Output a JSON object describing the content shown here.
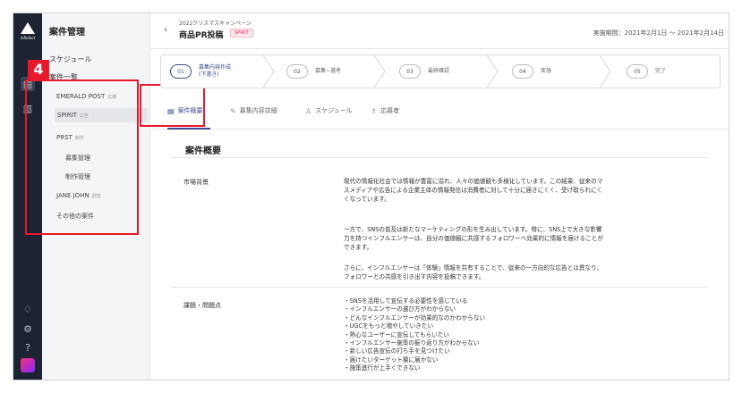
{
  "rail": {
    "logo_text": "influfact",
    "icons": [
      "grid-icon",
      "document-icon",
      "chart-icon",
      "bell-icon",
      "gear-icon",
      "help-icon"
    ]
  },
  "sidenav": {
    "title": "案件管理",
    "items": {
      "schedule": "スケジュール",
      "cases": "案件一覧",
      "emerald": {
        "label": "EMERALD POST",
        "tag": "広報"
      },
      "spirit": {
        "label": "SPIRIT",
        "tag": "広告"
      },
      "prst": {
        "label": "PRST",
        "tag": "制作"
      },
      "recruit": "募集管理",
      "production": "制作管理",
      "jane": {
        "label": "JANE JOHN",
        "tag": "調査"
      },
      "other": "その他の案件"
    }
  },
  "annotation": {
    "number": "4",
    "color": "#e8192c"
  },
  "header": {
    "back": "‹",
    "campaign": "2022クリスマスキャンペーン",
    "title": "商品PR投稿",
    "badge": "SPIRIT",
    "period": "実施期間：2021年2月1日 〜 2021年2月14日"
  },
  "steps": [
    {
      "num": "01",
      "label": "募集内容作成",
      "sub": "(下書き)",
      "active": true
    },
    {
      "num": "02",
      "label": "募集~選考",
      "sub": "",
      "active": false
    },
    {
      "num": "03",
      "label": "最終確認",
      "sub": "",
      "active": false
    },
    {
      "num": "04",
      "label": "実施",
      "sub": "",
      "active": false
    },
    {
      "num": "05",
      "label": "完了",
      "sub": "",
      "active": false
    }
  ],
  "tabs": {
    "overview": "案件概要",
    "details": "募集内容詳細",
    "schedule": "スケジュール",
    "applicants": "応募者"
  },
  "content": {
    "section_title": "案件概要",
    "market_label": "市場背景",
    "market_p1": "現代の情報化社会では情報が豊富に溢れ、人々の価値観も多様化しています。この結果、従来のマスメディアや広告による企業主体の情報発信は消費者に対して十分に届きにくく、受け取られにくくなっています。",
    "market_p2": "一方で、SNSの普及は新たなマーケティングの形を生み出しています。特に、SNS上で大きな影響力を持つインフルエンサーは、自分の価値観に共感するフォロワーへ効果的に情報を届けることができます。",
    "market_p3": "さらに、インフルエンサーは「体験」情報を共有することで、従来の一方向的な広告とは異なり、フォロワーとの共感を引き出す内容を投稿できます。",
    "issues_label": "課題・問題点",
    "issues": [
      "・SNSを活用して宣伝する必要性を感じている",
      "・インフルエンサーの選び方がわからない",
      "・どんなインフルエンサーが効果的なのかわからない",
      "・UGCをもっと増やしていきたい",
      "・熱心なユーザーに宣伝してもらいたい",
      "・インフルエンサー施策の振り返り方がわからない",
      "・新しい広告宣伝の打ち手を見つけたい",
      "・届けたいターゲット層に届かない",
      "・施策進行が上手くできない"
    ]
  },
  "colors": {
    "accent": "#3b4a8a",
    "rail": "#1d2333",
    "highlight": "#e8192c"
  }
}
